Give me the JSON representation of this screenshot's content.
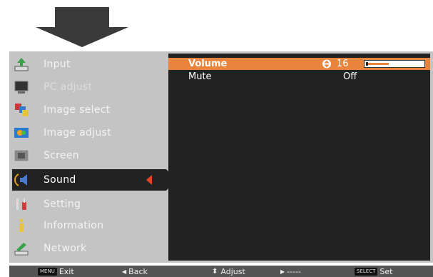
{
  "menu": {
    "items": [
      {
        "label": "Input",
        "icon": "input-icon"
      },
      {
        "label": "PC adjust",
        "icon": "pc-adjust-icon"
      },
      {
        "label": "Image select",
        "icon": "image-select-icon"
      },
      {
        "label": "Image adjust",
        "icon": "image-adjust-icon"
      },
      {
        "label": "Screen",
        "icon": "screen-icon"
      },
      {
        "label": "Sound",
        "icon": "sound-icon",
        "active": true
      },
      {
        "label": "Setting",
        "icon": "setting-icon"
      },
      {
        "label": "Information",
        "icon": "information-icon"
      },
      {
        "label": "Network",
        "icon": "network-icon"
      }
    ]
  },
  "sound": {
    "volume_label": "Volume",
    "volume_value": "16",
    "volume_level": 0.4,
    "mute_label": "Mute",
    "mute_value": "Off"
  },
  "footer": {
    "menu_key": "MENU",
    "exit": "Exit",
    "back": "Back",
    "adjust": "Adjust",
    "next": "-----",
    "select_key": "SELECT",
    "set": "Set"
  },
  "colors": {
    "accent": "#e8843c",
    "panel": "#222222",
    "frame": "#c4c4c4",
    "marker": "#e34624"
  }
}
